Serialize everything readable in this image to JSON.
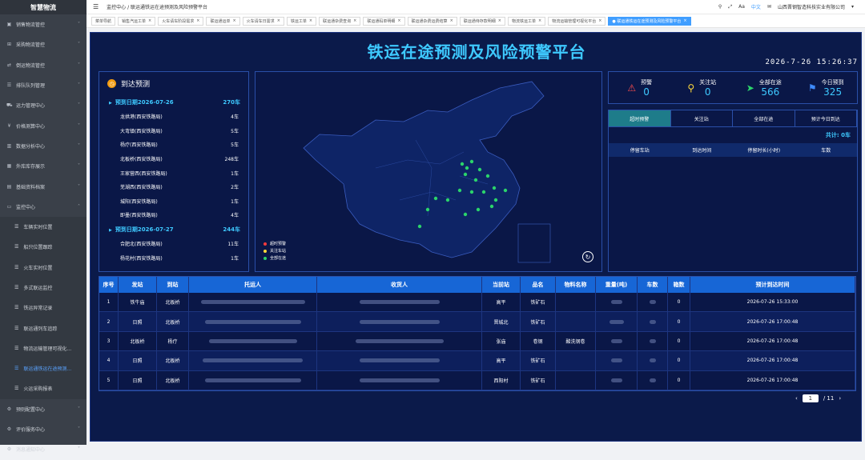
{
  "sidebar": {
    "logo": "智慧物流",
    "items": [
      {
        "label": "销售物流管控",
        "icon": "box-icon"
      },
      {
        "label": "采购物流管控",
        "icon": "cart-icon"
      },
      {
        "label": "倒运物流管控",
        "icon": "swap-icon"
      },
      {
        "label": "排队队列管理",
        "icon": "queue-icon"
      },
      {
        "label": "运力管理中心",
        "icon": "truck-icon"
      },
      {
        "label": "价格测算中心",
        "icon": "price-icon"
      },
      {
        "label": "数据分析中心",
        "icon": "chart-icon"
      },
      {
        "label": "外库库存展示",
        "icon": "warehouse-icon"
      },
      {
        "label": "基础资料档案",
        "icon": "file-icon"
      },
      {
        "label": "监控中心",
        "icon": "monitor-icon"
      }
    ],
    "sub": [
      {
        "label": "车辆实时位置"
      },
      {
        "label": "船只位置跟踪"
      },
      {
        "label": "火车实时位置"
      },
      {
        "label": "多式联运监控"
      },
      {
        "label": "铁运异常记录"
      },
      {
        "label": "联运通列车追踪"
      },
      {
        "label": "物流运输管理可视化..."
      },
      {
        "label": "联运通铁运在途预测..."
      },
      {
        "label": "火运采购报表"
      }
    ],
    "bottom": [
      {
        "label": "预则配置中心"
      },
      {
        "label": "评价服务中心"
      },
      {
        "label": "消息通知中心"
      }
    ]
  },
  "topbar": {
    "crumb": "监控中心 / 联运通铁运在途预测及风险预警平台",
    "lang": "中文",
    "company": "山西晋钢智造科技实业有限公司"
  },
  "tabs": [
    "菜单导航",
    "销售汽运工单",
    "火车请车阶段需求",
    "联运通运单",
    "火车请车日需求",
    "铁运工单",
    "联运通杂费查询",
    "联运通码单明细",
    "联运通杂费运费结算",
    "联运通待存款明细",
    "物流铁运工单",
    "物流运输管理可视化平台",
    "● 联运通铁运在途预测及风险预警平台"
  ],
  "title": "铁运在途预测及风险预警平台",
  "datetime": "2026-7-26 15:26:37",
  "arrival": {
    "title": "到达预测",
    "groups": [
      {
        "date": "预到日期2026-07-26",
        "count": "270车",
        "stations": [
          [
            "龙拱港(西安铁路局)",
            "4车"
          ],
          [
            "大弯镇(西安铁路局)",
            "5车"
          ],
          [
            "杨疗(西安铁路局)",
            "5车"
          ],
          [
            "北板桥(西安铁路局)",
            "248车"
          ],
          [
            "王家营西(西安铁路局)",
            "1车"
          ],
          [
            "芜湖西(西安铁路局)",
            "2车"
          ],
          [
            "城阳(西安铁路局)",
            "1车"
          ],
          [
            "即墨(西安铁路局)",
            "4车"
          ]
        ]
      },
      {
        "date": "预到日期2026-07-27",
        "count": "244车",
        "stations": [
          [
            "合肥北(西安铁路局)",
            "11车"
          ],
          [
            "杨花村(西安铁路局)",
            "1车"
          ]
        ]
      }
    ]
  },
  "map": {
    "legend": [
      {
        "label": "超时预警",
        "color": "#ff3b3b"
      },
      {
        "label": "关注车站",
        "color": "#ffd93b"
      },
      {
        "label": "全部在途",
        "color": "#2bd46b"
      }
    ]
  },
  "stats": [
    {
      "label": "预警",
      "value": "0",
      "icon": "alarm-icon",
      "color": "#ff4d4d"
    },
    {
      "label": "关注站",
      "value": "0",
      "icon": "pin-icon",
      "color": "#ffd93b"
    },
    {
      "label": "全部在途",
      "value": "566",
      "icon": "send-icon",
      "color": "#2bd46b"
    },
    {
      "label": "今日预到",
      "value": "325",
      "icon": "flag-icon",
      "color": "#3e8bff"
    }
  ],
  "ftabs": [
    "超时预警",
    "关注站",
    "全部在途",
    "预计今日到达"
  ],
  "total": "共计: 0车",
  "thead": [
    "停留车站",
    "到达时间",
    "停留时长(小时)",
    "车数"
  ],
  "table": {
    "headers": [
      "序号",
      "发站",
      "到站",
      "托运人",
      "收货人",
      "当前站",
      "品名",
      "物料名称",
      "重量(吨)",
      "车数",
      "箱数",
      "预计到达时间"
    ],
    "rows": [
      [
        "1",
        "铁牛庙",
        "北板桥",
        "",
        "",
        "高平",
        "铁矿石",
        "",
        "",
        "",
        "0",
        "2026-07-26 15:33:00"
      ],
      [
        "2",
        "日照",
        "北板桥",
        "",
        "",
        "晋城北",
        "铁矿石",
        "",
        "",
        "",
        "0",
        "2026-07-26 17:00:48"
      ],
      [
        "3",
        "北板桥",
        "杨疗",
        "",
        "",
        "张庙",
        "卷钢",
        "酸洗钢卷",
        "",
        "",
        "0",
        "2026-07-26 17:00:48"
      ],
      [
        "4",
        "日照",
        "北板桥",
        "",
        "",
        "高平",
        "铁矿石",
        "",
        "",
        "",
        "0",
        "2026-07-26 17:00:48"
      ],
      [
        "5",
        "日照",
        "北板桥",
        "",
        "",
        "西阳村",
        "铁矿石",
        "",
        "",
        "",
        "0",
        "2026-07-26 17:00:48"
      ]
    ]
  },
  "pager": {
    "current": "1",
    "total": "/ 11"
  }
}
